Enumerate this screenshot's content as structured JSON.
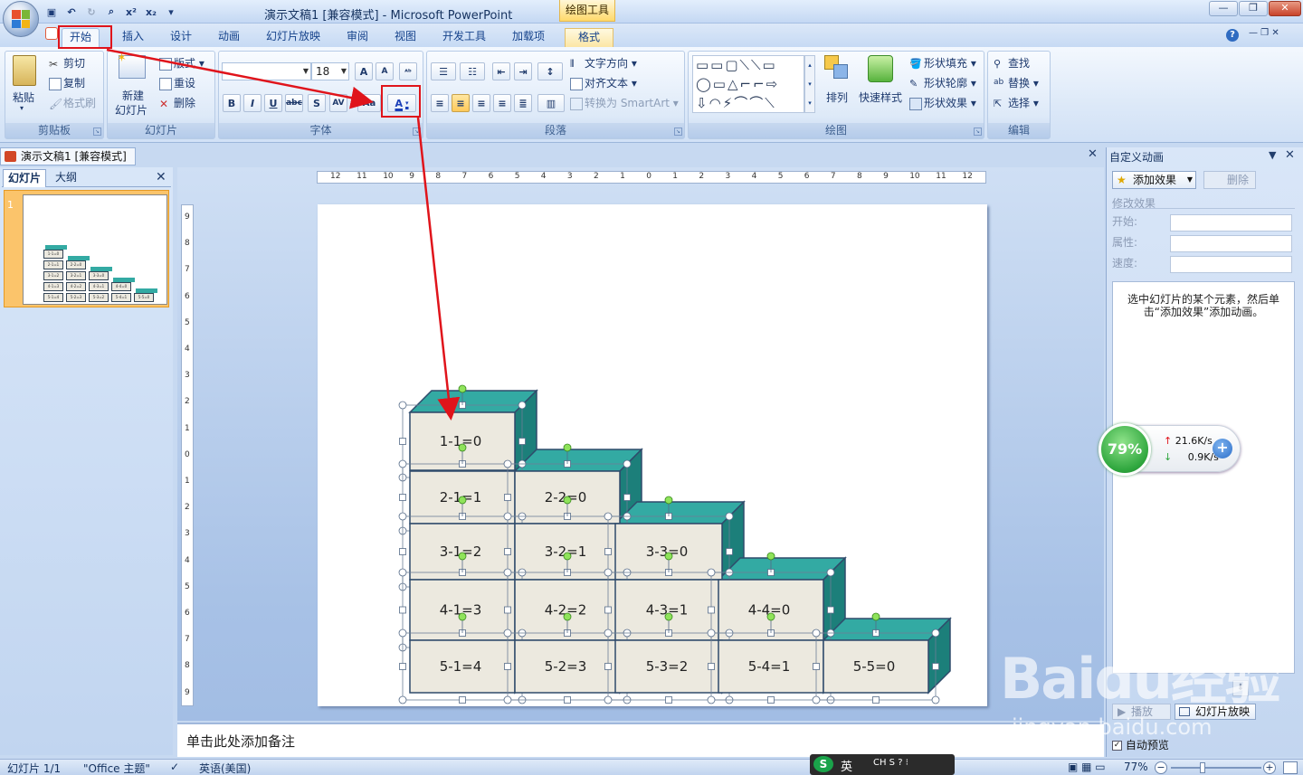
{
  "window": {
    "title": "演示文稿1 [兼容模式] - Microsoft PowerPoint",
    "contextual_tab_group": "绘图工具",
    "controls": [
      "—",
      "❐",
      "✕"
    ]
  },
  "tabs": [
    {
      "label": "开始",
      "active": true
    },
    {
      "label": "插入"
    },
    {
      "label": "设计"
    },
    {
      "label": "动画"
    },
    {
      "label": "幻灯片放映"
    },
    {
      "label": "审阅"
    },
    {
      "label": "视图"
    },
    {
      "label": "开发工具"
    },
    {
      "label": "加载项"
    },
    {
      "label": "格式"
    }
  ],
  "ribbon": {
    "clipboard": {
      "label": "剪贴板",
      "paste": "粘贴",
      "cut": "剪切",
      "copy": "复制",
      "format_painter": "格式刷"
    },
    "slides": {
      "label": "幻灯片",
      "new_slide_1": "新建",
      "new_slide_2": "幻灯片",
      "layout": "版式",
      "reset": "重设",
      "delete": "删除"
    },
    "font": {
      "label": "字体",
      "font_name": "",
      "font_size": "18",
      "bold": "B",
      "italic": "I",
      "underline": "U",
      "strike": "abc",
      "shadow": "S",
      "spacing": "AV",
      "case": "Aa",
      "color": "A",
      "grow": "A",
      "shrink": "A"
    },
    "paragraph": {
      "label": "段落",
      "text_direction": "文字方向",
      "align_text": "对齐文本",
      "smartart": "转换为 SmartArt"
    },
    "drawing": {
      "label": "绘图",
      "arrange": "排列",
      "quick_styles": "快速样式",
      "shape_fill": "形状填充",
      "shape_outline": "形状轮廓",
      "shape_effects": "形状效果"
    },
    "editing": {
      "label": "编辑",
      "find": "查找",
      "replace": "替换",
      "select": "选择"
    }
  },
  "document_tab": "演示文稿1 [兼容模式]",
  "left_panel": {
    "tabs": [
      "幻灯片",
      "大纲"
    ],
    "slide_number": "1"
  },
  "ruler": {
    "h_labels": [
      "12",
      "11",
      "10",
      "9",
      "8",
      "7",
      "6",
      "5",
      "4",
      "3",
      "2",
      "1",
      "0",
      "1",
      "2",
      "3",
      "4",
      "5",
      "6",
      "7",
      "8",
      "9",
      "10",
      "11",
      "12"
    ],
    "v_labels": [
      "9",
      "8",
      "7",
      "6",
      "5",
      "4",
      "3",
      "2",
      "1",
      "0",
      "1",
      "2",
      "3",
      "4",
      "5",
      "6",
      "7",
      "8",
      "9"
    ]
  },
  "slide": {
    "boxes": [
      {
        "col": 0,
        "row": 0,
        "text": "1-1=0"
      },
      {
        "col": 0,
        "row": 1,
        "text": "2-1=1"
      },
      {
        "col": 1,
        "row": 1,
        "text": "2-2=0"
      },
      {
        "col": 0,
        "row": 2,
        "text": "3-1=2"
      },
      {
        "col": 1,
        "row": 2,
        "text": "3-2=1"
      },
      {
        "col": 2,
        "row": 2,
        "text": "3-3=0"
      },
      {
        "col": 0,
        "row": 3,
        "text": "4-1=3"
      },
      {
        "col": 1,
        "row": 3,
        "text": "4-2=2"
      },
      {
        "col": 2,
        "row": 3,
        "text": "4-3=1"
      },
      {
        "col": 3,
        "row": 3,
        "text": "4-4=0"
      },
      {
        "col": 0,
        "row": 4,
        "text": "5-1=4"
      },
      {
        "col": 1,
        "row": 4,
        "text": "5-2=3"
      },
      {
        "col": 2,
        "row": 4,
        "text": "5-3=2"
      },
      {
        "col": 3,
        "row": 4,
        "text": "5-4=1"
      },
      {
        "col": 4,
        "row": 4,
        "text": "5-5=0"
      }
    ],
    "colors": {
      "front": "#ece9df",
      "top": "#33aaa3",
      "side": "#1c7f7a",
      "edge": "#2f4b6b"
    }
  },
  "notes_placeholder": "单击此处添加备注",
  "right_panel": {
    "title": "自定义动画",
    "add_effect": "添加效果",
    "remove": "删除",
    "modify": "修改效果",
    "start": "开始:",
    "property": "属性:",
    "speed": "速度:",
    "message": "选中幻灯片的某个元素，然后单击“添加效果”添加动画。",
    "play": "播放",
    "slideshow": "幻灯片放映",
    "autopreview": "自动预览"
  },
  "net_widget": {
    "percent": "79%",
    "up": "21.6K/s",
    "down": "0.9K/s"
  },
  "status": {
    "slide": "幻灯片 1/1",
    "theme": "\"Office 主题\"",
    "language": "英语(美国)",
    "zoom": "77%",
    "ime": "英"
  },
  "watermark": {
    "brand": "Baidu经验",
    "site": "jingyan.baidu.com"
  }
}
